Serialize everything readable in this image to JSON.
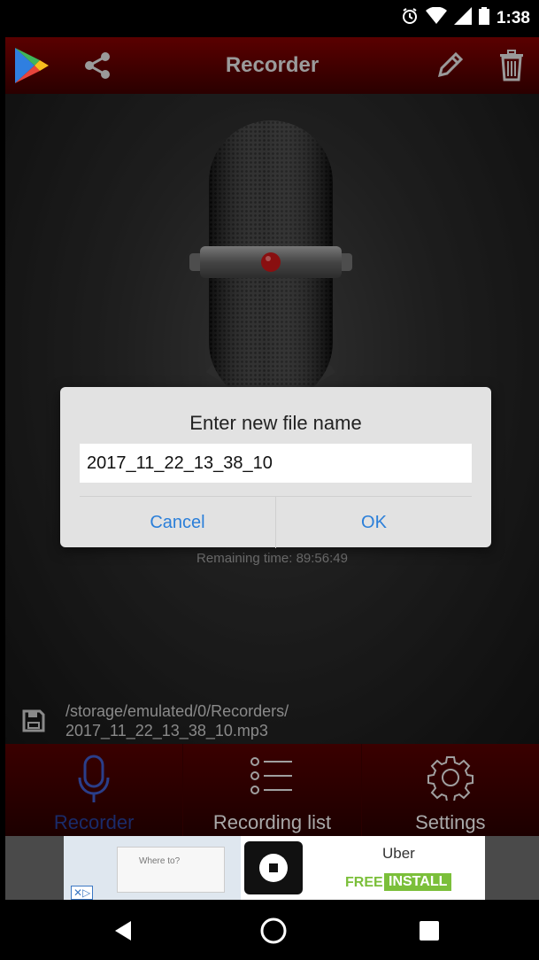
{
  "status_bar": {
    "time": "1:38",
    "icons": [
      "alarm-icon",
      "wifi-icon",
      "signal-icon",
      "battery-icon"
    ]
  },
  "app_bar": {
    "title": "Recorder",
    "icons": [
      "play-store-icon",
      "share-icon",
      "edit-icon",
      "delete-icon"
    ]
  },
  "main": {
    "remaining_time": "Remaining time: 89:56:49",
    "file_path_line1": "/storage/emulated/0/Recorders/",
    "file_path_line2": "2017_11_22_13_38_10.mp3"
  },
  "dialog": {
    "title": "Enter new file name",
    "input_value": "2017_11_22_13_38_10",
    "cancel_label": "Cancel",
    "ok_label": "OK"
  },
  "tabs": [
    {
      "label": "Recorder",
      "icon": "microphone-icon",
      "active": true
    },
    {
      "label": "Recording list",
      "icon": "list-icon",
      "active": false
    },
    {
      "label": "Settings",
      "icon": "gear-icon",
      "active": false
    }
  ],
  "ad": {
    "brand": "Uber",
    "free_label": "FREE",
    "install_label": "INSTALL",
    "small_text": "Where to?"
  },
  "nav_bar": {
    "icons": [
      "back-icon",
      "home-icon",
      "recents-icon"
    ]
  },
  "colors": {
    "app_bar": "#5a0000",
    "dialog_button": "#2b7fd9",
    "active_tab": "#1a2b6a",
    "install_green": "#7bbf3a"
  }
}
